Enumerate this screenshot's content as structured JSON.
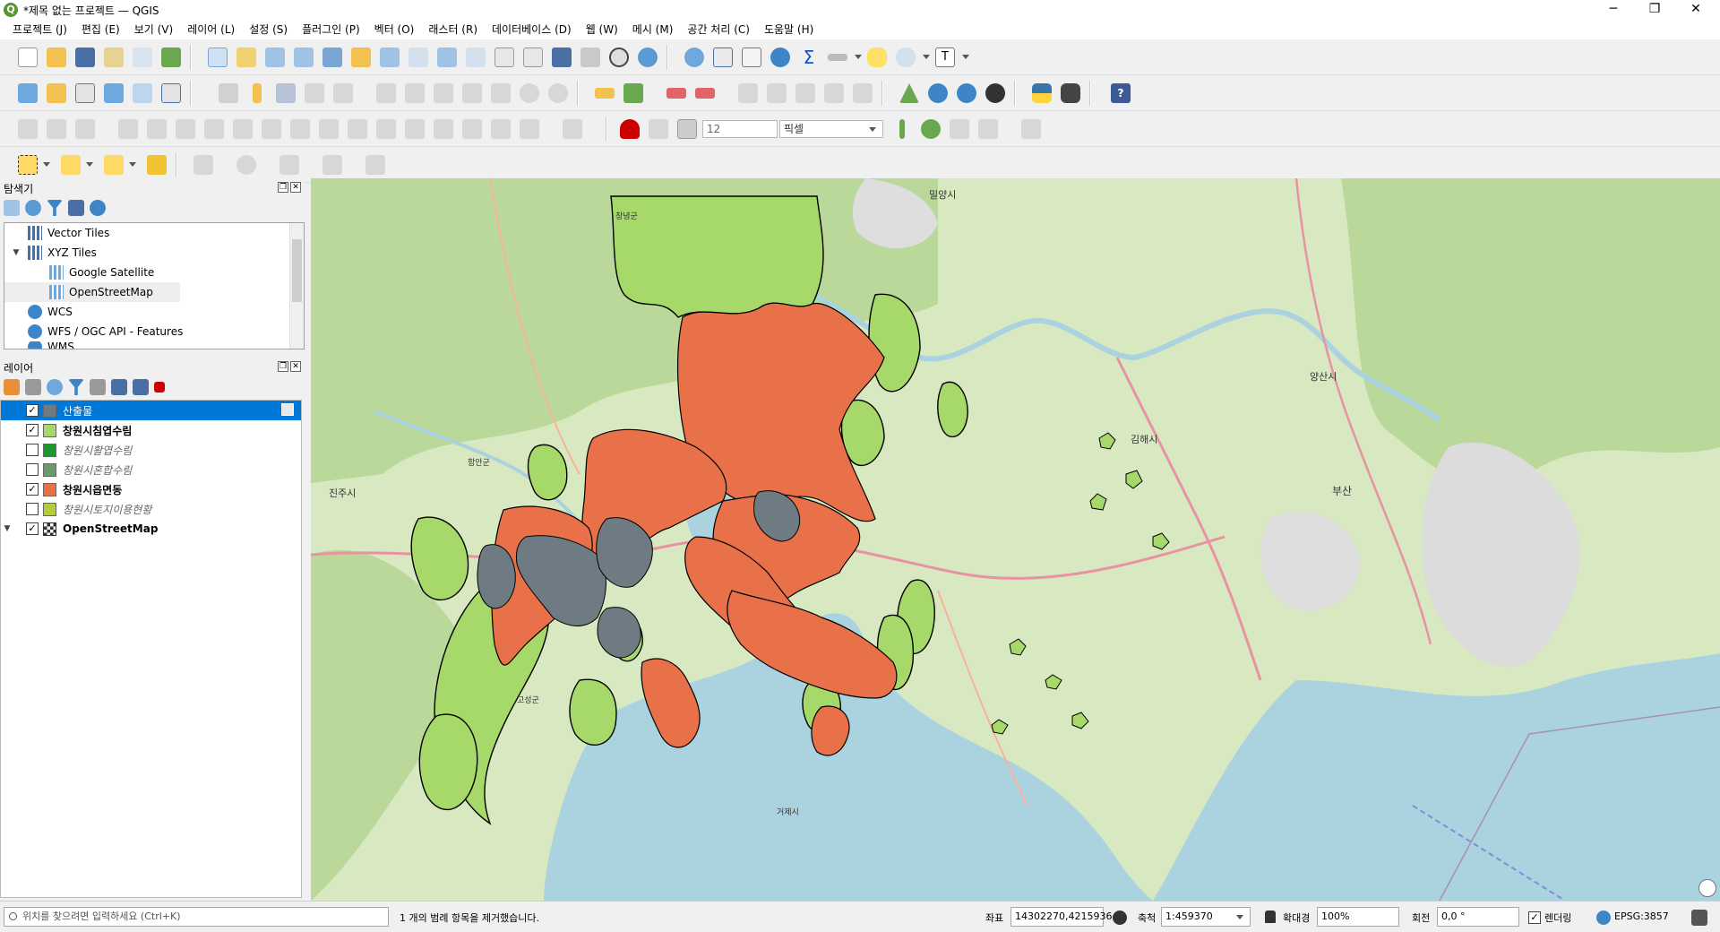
{
  "window": {
    "title": "*제목 없는 프로젝트 — QGIS",
    "minimize_glyph": "─",
    "maximize_glyph": "❐",
    "close_glyph": "✕"
  },
  "menu": [
    "프로젝트 (J)",
    "편집 (E)",
    "보기 (V)",
    "레이어 (L)",
    "설정 (S)",
    "플러그인 (P)",
    "벡터 (O)",
    "래스터 (R)",
    "데이터베이스 (D)",
    "웹 (W)",
    "메시 (M)",
    "공간 처리 (C)",
    "도움말 (H)"
  ],
  "digitizing": {
    "tolerance_value": "12",
    "tolerance_unit": "픽셀"
  },
  "browser_panel": {
    "title": "탐색기",
    "items": [
      {
        "label": "Vector Tiles",
        "icon": "vector-tiles-icon"
      },
      {
        "label": "XYZ Tiles",
        "icon": "xyz-tiles-icon"
      },
      {
        "label": "Google Satellite",
        "icon": "xyz-tile-layer-icon"
      },
      {
        "label": "OpenStreetMap",
        "icon": "xyz-tile-layer-icon"
      },
      {
        "label": "WCS",
        "icon": "globe-icon"
      },
      {
        "label": "WFS / OGC API - Features",
        "icon": "globe-icon"
      },
      {
        "label": "WMS",
        "icon": "globe-icon"
      }
    ]
  },
  "layers_panel": {
    "title": "레이어",
    "layers": [
      {
        "name": "산출물",
        "checked": true,
        "color": "#6f7b82",
        "selected": true
      },
      {
        "name": "창원시침엽수림",
        "checked": true,
        "color": "#a6d96a",
        "bold": true
      },
      {
        "name": "창원시활엽수림",
        "checked": false,
        "color": "#1a9a2e",
        "italic": true
      },
      {
        "name": "창원시혼합수림",
        "checked": false,
        "color": "#6a9a6e",
        "italic": true
      },
      {
        "name": "창원시읍면동",
        "checked": true,
        "color": "#e8714a",
        "bold": true
      },
      {
        "name": "창원시토지이용현황",
        "checked": false,
        "color": "#b5cc3c",
        "italic": true
      },
      {
        "name": "OpenStreetMap",
        "checked": true,
        "color": "#ffffff",
        "bold": true
      }
    ]
  },
  "map": {
    "labels": [
      {
        "t": "밀양시"
      },
      {
        "t": "양산시"
      },
      {
        "t": "김해시"
      },
      {
        "t": "부산"
      },
      {
        "t": "진주시"
      },
      {
        "t": "창녕군"
      },
      {
        "t": "함안군"
      },
      {
        "t": "고성군"
      },
      {
        "t": "거제시"
      }
    ],
    "colors": {
      "sea": "#aad3df",
      "land": "#d8e9c2",
      "forest": "#b9d89a",
      "urban": "#dcdcdc",
      "broadleaf": "#a6d96a",
      "district": "#e8714a",
      "output": "#6f7b82"
    }
  },
  "statusbar": {
    "locator_placeholder": "위치를 찾으려면 입력하세요 (Ctrl+K)",
    "message": "1 개의 범례 항목을 제거했습니다.",
    "coord_label": "좌표",
    "coord_value": "14302270,4215936",
    "scale_label": "축척",
    "scale_value": "1:459370",
    "magnifier_label": "확대경",
    "magnifier_value": "100%",
    "rotation_label": "회전",
    "rotation_value": "0,0 °",
    "render_label": "렌더링",
    "crs": "EPSG:3857"
  }
}
